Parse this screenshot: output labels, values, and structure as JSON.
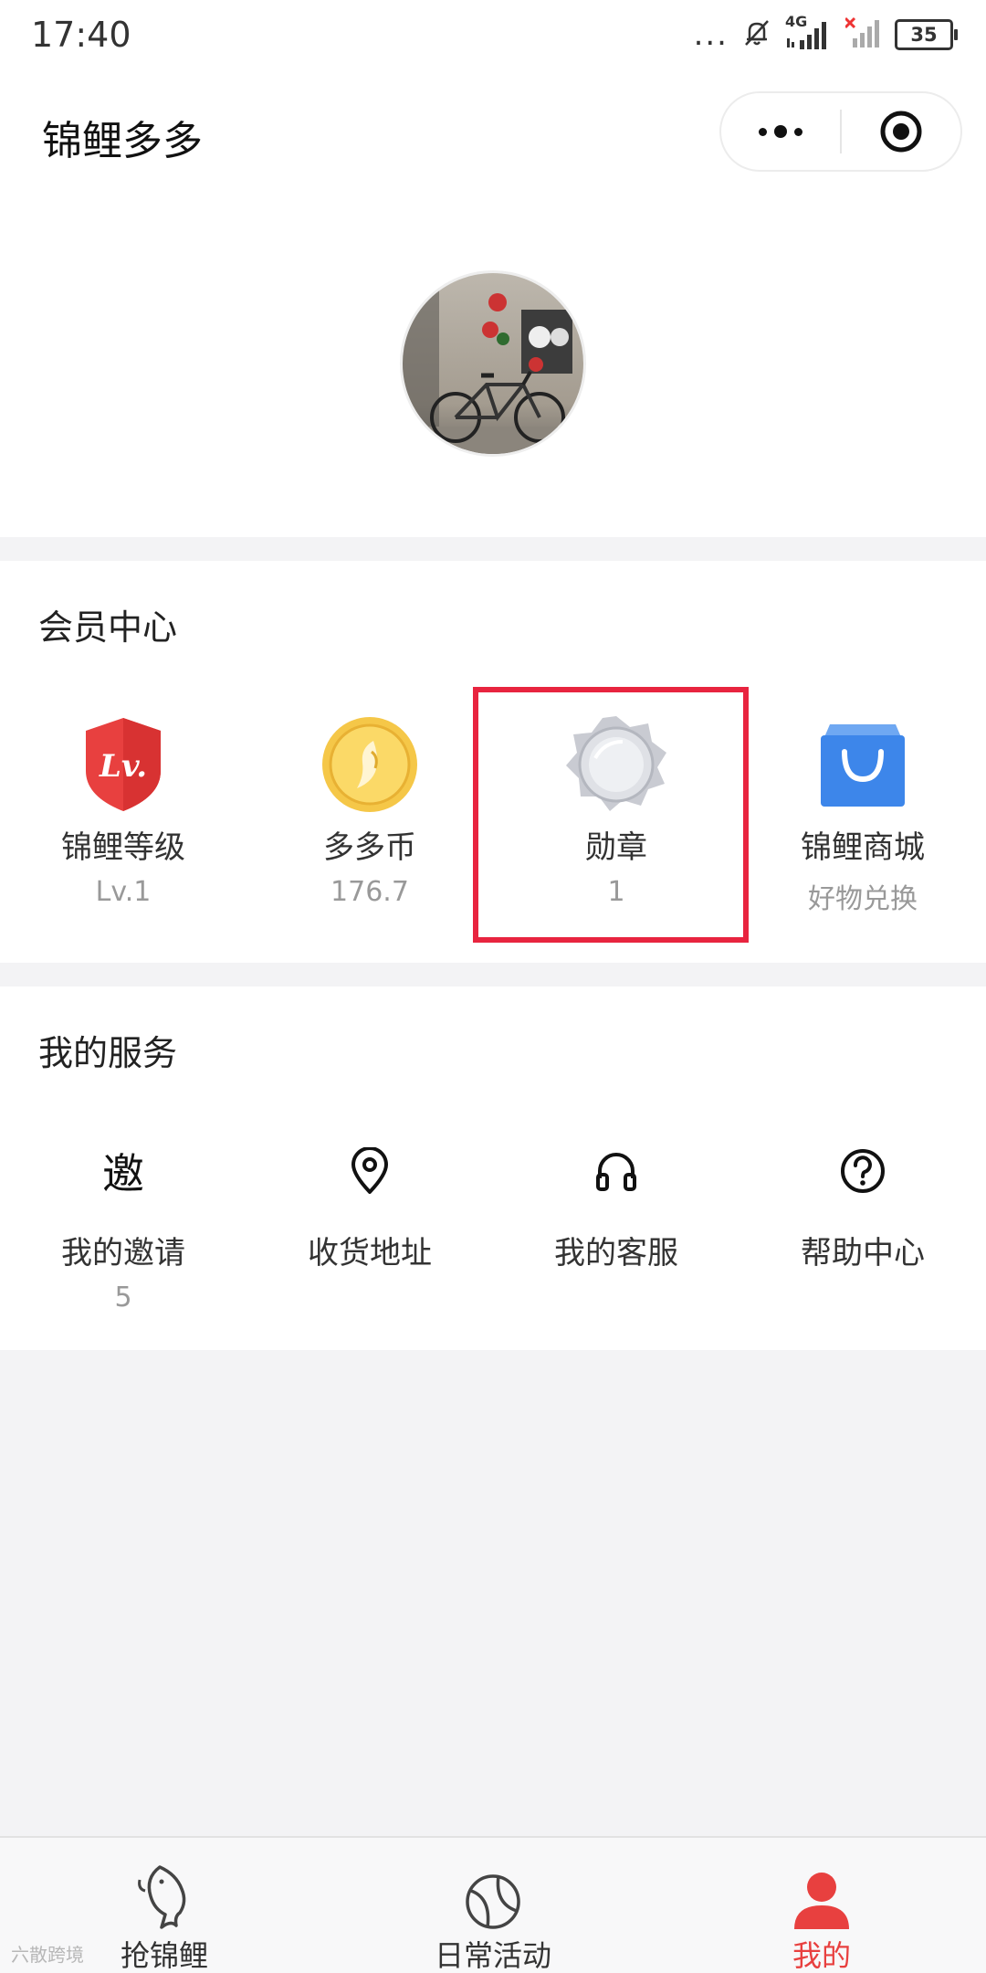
{
  "status_bar": {
    "time": "17:40",
    "dots": "...",
    "network": "4G",
    "battery": "35"
  },
  "title_bar": {
    "title": "锦鲤多多",
    "more_icon": "more-dots-icon",
    "close_icon": "target-close-icon"
  },
  "profile": {
    "avatar_icon": "bicycle-photo-avatar"
  },
  "member_center": {
    "title": "会员中心",
    "items": [
      {
        "label": "锦鲤等级",
        "sub": "Lv.1",
        "icon": "level-shield-icon",
        "badge_text": "Lv."
      },
      {
        "label": "多多币",
        "sub": "176.7",
        "icon": "coin-icon"
      },
      {
        "label": "勋章",
        "sub": "1",
        "icon": "medal-icon"
      },
      {
        "label": "锦鲤商城",
        "sub": "好物兑换",
        "icon": "shopping-bag-icon"
      }
    ]
  },
  "services": {
    "title": "我的服务",
    "items": [
      {
        "label": "我的邀请",
        "sub": "5",
        "icon": "invite-icon",
        "glyph": "邀"
      },
      {
        "label": "收货地址",
        "sub": "",
        "icon": "location-pin-icon"
      },
      {
        "label": "我的客服",
        "sub": "",
        "icon": "headset-icon"
      },
      {
        "label": "帮助中心",
        "sub": "",
        "icon": "help-circle-icon"
      }
    ]
  },
  "tab_bar": {
    "tabs": [
      {
        "label": "抢锦鲤",
        "icon": "koi-fish-icon"
      },
      {
        "label": "日常活动",
        "icon": "ball-icon"
      },
      {
        "label": "我的",
        "icon": "user-icon",
        "active": true
      }
    ],
    "active_color": "#e8403f"
  },
  "watermark": {
    "text": "六散跨境"
  },
  "colors": {
    "highlight": "#e8243f",
    "background": "#f3f3f5"
  }
}
